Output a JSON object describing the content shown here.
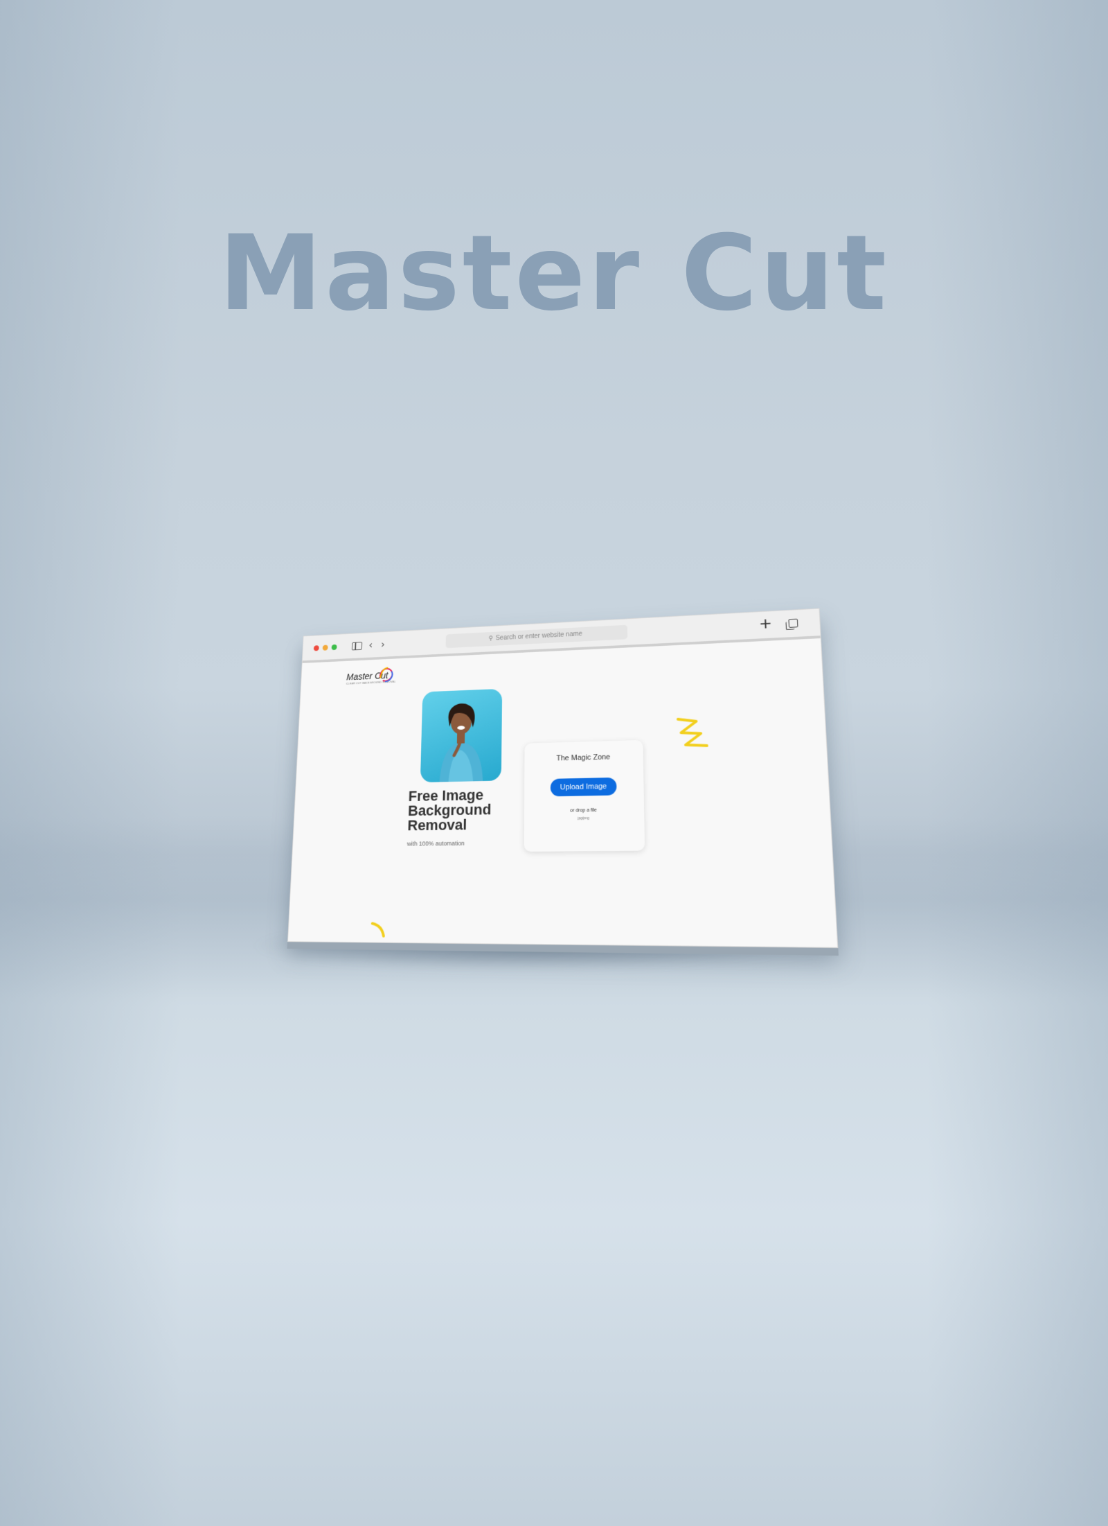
{
  "hero": {
    "title": "Master Cut"
  },
  "browser": {
    "address_placeholder": "Search or enter website name",
    "nav_back": "‹",
    "nav_forward": "›",
    "new_tab": "+"
  },
  "page": {
    "logo": {
      "name": "Master Cut",
      "tagline": "CLEAR CUT BACKGROUND REMOVAL"
    },
    "headline_lines": [
      "Free Image",
      "Background",
      "Removal"
    ],
    "subtitle": "with 100% automation",
    "magic_zone": {
      "title": "The Magic Zone",
      "upload_label": "Upload Image",
      "drop_text": "or drop a file",
      "formats": "jpg/png"
    }
  },
  "colors": {
    "accent_button": "#0d6ce0",
    "hero_title": "#8aa0b6",
    "photo_bg": "#3bbfe0",
    "squiggle": "#f2cf1d"
  }
}
